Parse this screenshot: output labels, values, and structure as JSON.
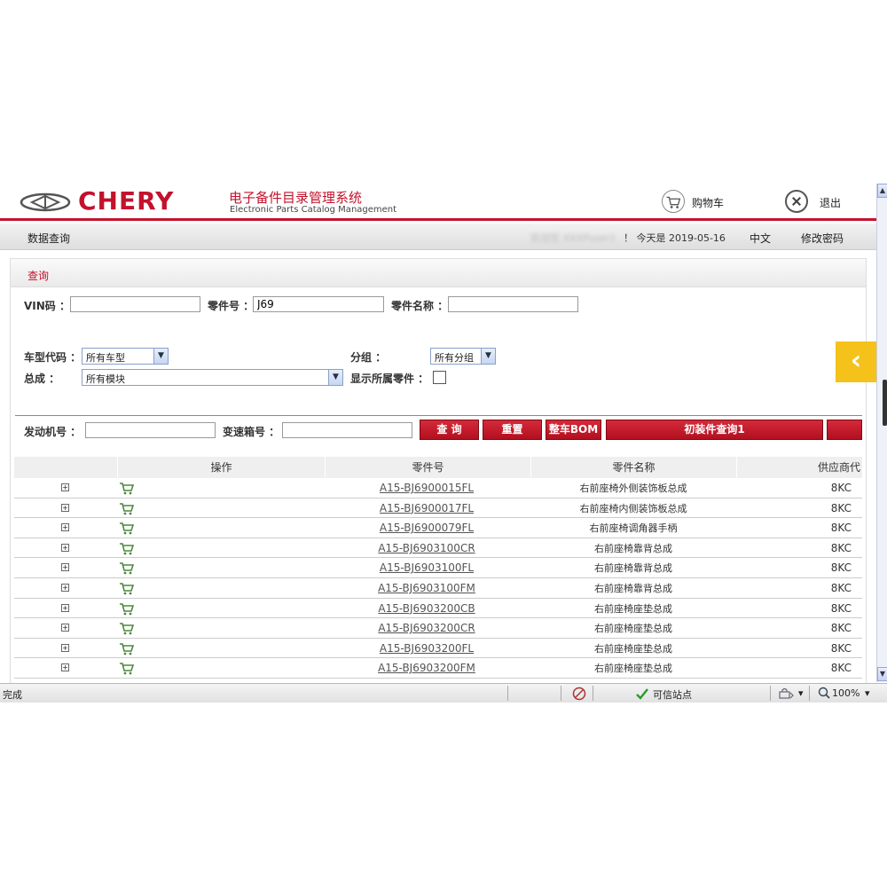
{
  "header": {
    "logo_text": "CHERY",
    "system_cn": "电子备件目录管理系统",
    "system_en": "Electronic Parts Catalog Management",
    "cart_label": "购物车",
    "exit_label": "退出"
  },
  "nav": {
    "data_query": "数据查询",
    "user_blurred": "欢迎您 XXXPuser1",
    "today": "！ 今天是 2019-05-16",
    "language": "中文",
    "change_password": "修改密码"
  },
  "query": {
    "title": "查询",
    "vin_label": "VIN码 ：",
    "vin_value": "",
    "partno_label": "零件号 ：",
    "partno_value": "J69",
    "partname_label": "零件名称 ：",
    "partname_value": "",
    "model_label": "车型代码 ：",
    "model_value": "所有车型",
    "group_label": "分组 ：",
    "group_value": "所有分组",
    "assembly_label": "总成 ：",
    "assembly_value": "所有模块",
    "show_all_label": "显示所属零件 ：",
    "engine_label": "发动机号 ：",
    "engine_value": "",
    "gearbox_label": "变速箱号 ：",
    "gearbox_value": ""
  },
  "buttons": {
    "search": "查 询",
    "reset": "重置",
    "bom": "整车BOM",
    "initial": "初装件查询1"
  },
  "table": {
    "headers": [
      "操作",
      "零件号",
      "零件名称",
      "供应商代"
    ],
    "rows": [
      {
        "expander": "+",
        "part_no": "A15-BJ6900015FL",
        "part_name": "右前座椅外侧装饰板总成",
        "supplier": "8KC"
      },
      {
        "expander": "+",
        "part_no": "A15-BJ6900017FL",
        "part_name": "右前座椅内侧装饰板总成",
        "supplier": "8KC"
      },
      {
        "expander": "+",
        "part_no": "A15-BJ6900079FL",
        "part_name": "右前座椅调角器手柄",
        "supplier": "8KC"
      },
      {
        "expander": "+",
        "part_no": "A15-BJ6903100CR",
        "part_name": "右前座椅靠背总成",
        "supplier": "8KC"
      },
      {
        "expander": "+",
        "part_no": "A15-BJ6903100FL",
        "part_name": "右前座椅靠背总成",
        "supplier": "8KC"
      },
      {
        "expander": "+",
        "part_no": "A15-BJ6903100FM",
        "part_name": "右前座椅靠背总成",
        "supplier": "8KC"
      },
      {
        "expander": "+",
        "part_no": "A15-BJ6903200CB",
        "part_name": "右前座椅座垫总成",
        "supplier": "8KC"
      },
      {
        "expander": "+",
        "part_no": "A15-BJ6903200CR",
        "part_name": "右前座椅座垫总成",
        "supplier": "8KC"
      },
      {
        "expander": "+",
        "part_no": "A15-BJ6903200FL",
        "part_name": "右前座椅座垫总成",
        "supplier": "8KC"
      },
      {
        "expander": "+",
        "part_no": "A15-BJ6903200FM",
        "part_name": "右前座椅座垫总成",
        "supplier": "8KC"
      }
    ]
  },
  "side_tab": "‹",
  "statusbar": {
    "done": "完成",
    "trusted": "可信站点",
    "zoom": "100%"
  },
  "colors": {
    "brand_red": "#c3122c",
    "accent_yellow": "#f4c21a"
  }
}
